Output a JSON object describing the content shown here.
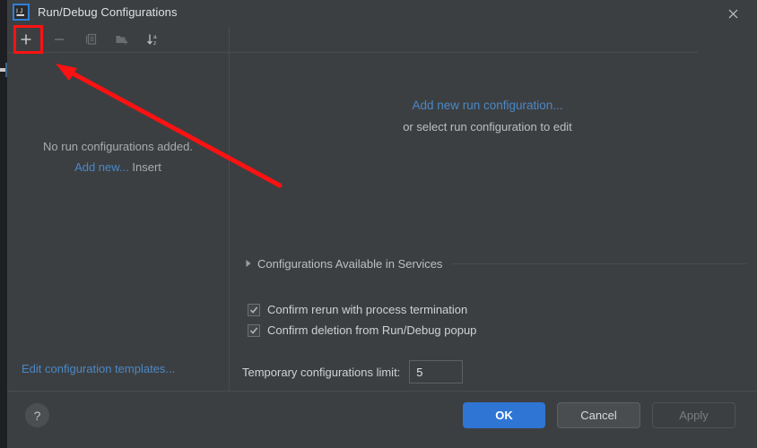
{
  "window": {
    "title": "Run/Debug Configurations",
    "app_icon": "intellij-idea-icon",
    "close_icon": "close-icon"
  },
  "toolbar": {
    "buttons": [
      {
        "name": "add-configuration-button",
        "icon": "plus-icon",
        "enabled": true,
        "tooltip": "Add New Configuration"
      },
      {
        "name": "remove-configuration-button",
        "icon": "minus-icon",
        "enabled": false,
        "tooltip": "Remove Configuration"
      },
      {
        "name": "copy-configuration-button",
        "icon": "copy-icon",
        "enabled": false,
        "tooltip": "Copy Configuration"
      },
      {
        "name": "new-folder-button",
        "icon": "folder-plus-icon",
        "enabled": false,
        "tooltip": "Create New Folder"
      },
      {
        "name": "sort-configurations-button",
        "icon": "sort-alpha-icon",
        "enabled": true,
        "tooltip": "Sort Configurations"
      }
    ]
  },
  "left_panel": {
    "empty_message": "No run configurations added.",
    "add_new_link": "Add new...",
    "add_new_shortcut": "Insert",
    "edit_templates_link": "Edit configuration templates..."
  },
  "right_panel": {
    "add_link": "Add new run configuration...",
    "subtitle": "or select run configuration to edit",
    "services_section": {
      "label": "Configurations Available in Services",
      "expanded": false,
      "triangle_icon": "chevron-right-icon"
    },
    "checkboxes": [
      {
        "label": "Confirm rerun with process termination",
        "checked": true
      },
      {
        "label": "Confirm deletion from Run/Debug popup",
        "checked": true
      }
    ],
    "temporary_limit": {
      "label": "Temporary configurations limit:",
      "value": "5"
    }
  },
  "footer": {
    "help_label": "?",
    "ok_label": "OK",
    "cancel_label": "Cancel",
    "apply_label": "Apply",
    "apply_enabled": false
  },
  "annotation": {
    "highlight_color": "#fb1212",
    "arrow_color": "#fb1212",
    "target": "add-configuration-button"
  },
  "colors": {
    "dialog_bg": "#3c3f41",
    "window_bg": "#1e1f22",
    "link": "#4a88c7",
    "primary_button": "#2f75d4",
    "text": "#cfd2d4",
    "muted_text": "#a9acae",
    "divider": "#4a4d4f"
  }
}
